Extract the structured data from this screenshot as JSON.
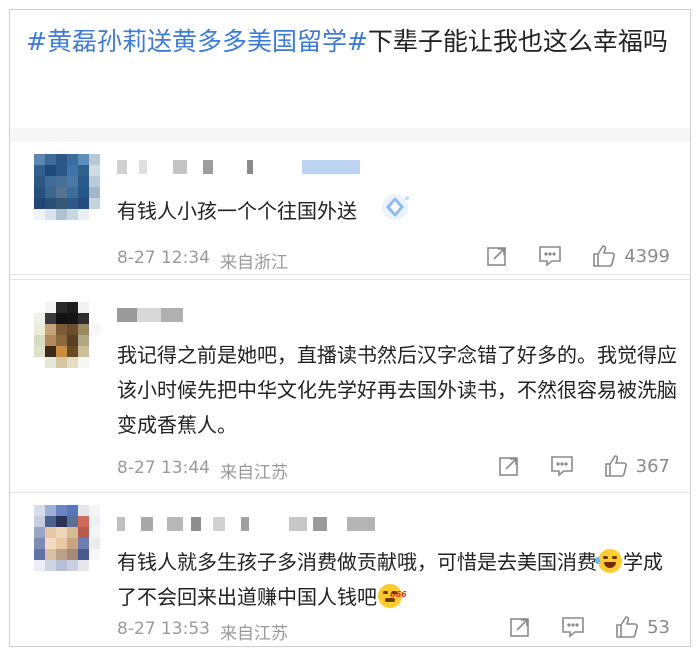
{
  "post": {
    "hashtag": "#黄磊孙莉送黄多多美国留学#",
    "title_rest": "下辈子能让我也这么幸福吗"
  },
  "comments": [
    {
      "text": "有钱人小孩一个个往国外送",
      "date": "8-27 12:34",
      "location": "来自浙江",
      "likes": "4399",
      "badge_icon": "diamond-badge-icon"
    },
    {
      "text": "我记得之前是她吧，直播读书然后汉字念错了好多的。我觉得应该小时候先把中华文化先学好再去国外读书，不然很容易被洗脑变成香蕉人。",
      "date": "8-27 13:44",
      "location": "来自江苏",
      "likes": "367"
    },
    {
      "text_part1": "有钱人就多生孩子多消费做贡献哦，可惜是去美国消费",
      "text_part2": "学成了不会回来出道赚中国人钱吧",
      "emoji1": "laughing-tears-emoji",
      "emoji2": "666-emoji",
      "date": "8-27 13:53",
      "location": "来自江苏",
      "likes": "53"
    }
  ],
  "icons": {
    "share": "share-icon",
    "comment": "comment-icon",
    "like": "thumbs-up-icon"
  },
  "colors": {
    "hashtag": "#3f7bd6",
    "meta": "#9a9a9a"
  }
}
